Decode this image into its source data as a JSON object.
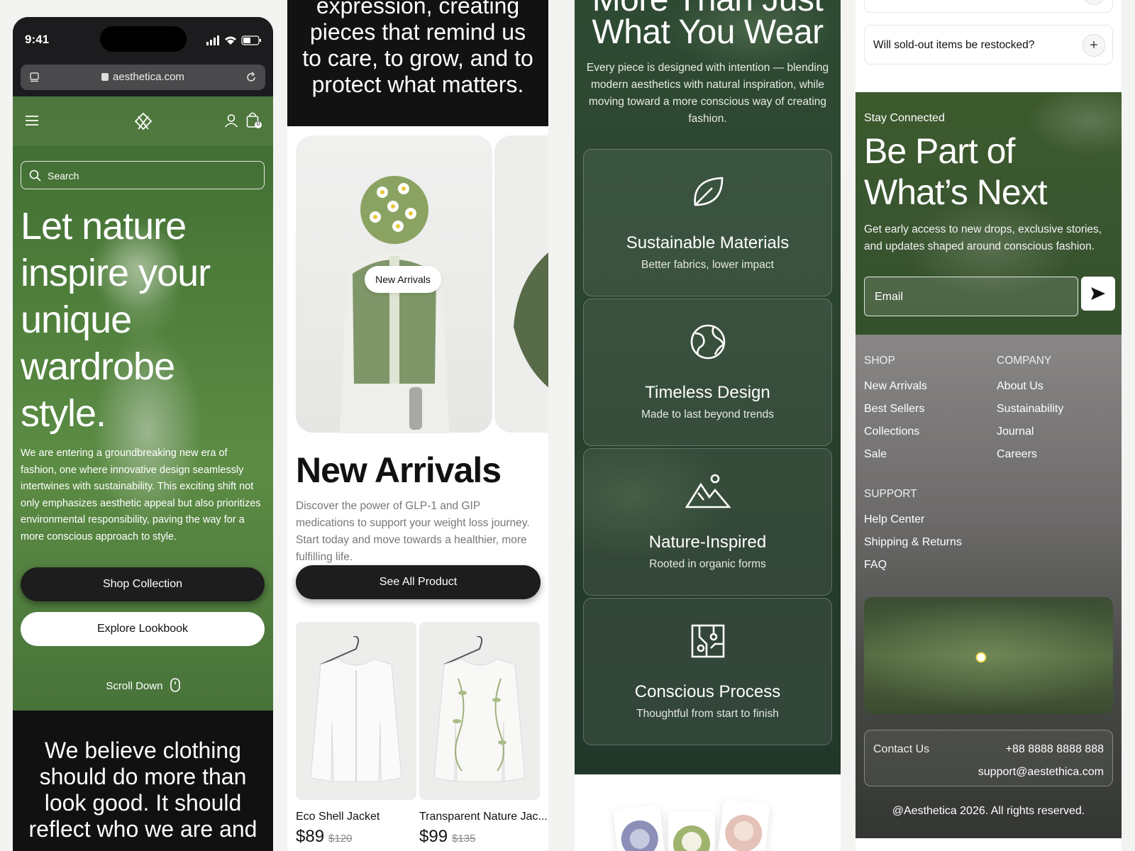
{
  "phone": {
    "time": "9:41",
    "url": "aesthetica.com",
    "search_placeholder": "Search",
    "hero_title": "Let nature inspire your unique wardrobe style.",
    "hero_text": "We are entering a groundbreaking new era of fashion, one where innovative design seamlessly intertwines with sustainability. This exciting shift not only emphasizes aesthetic appeal but also prioritizes environmental responsibility, paving the way for a more conscious approach to style.",
    "shop_button": "Shop Collection",
    "lookbook_button": "Explore Lookbook",
    "scroll_label": "Scroll Down",
    "cart_count": "0",
    "believe_text": "We believe clothing should do more than look good. It should reflect who we are and"
  },
  "col2": {
    "quote": "expression, creating pieces that remind us to care, to grow, and to protect what matters.",
    "pill_label": "New Arrivals",
    "title": "New Arrivals",
    "text": "Discover the power of GLP-1 and GIP medications to support your weight loss journey. Start today and move towards a healthier, more fulfilling life.",
    "see_all": "See All Product",
    "products": [
      {
        "name": "Eco Shell Jacket",
        "price": "$89",
        "old_price": "$120"
      },
      {
        "name": "Transparent Nature Jac...",
        "price": "$99",
        "old_price": "$135"
      }
    ]
  },
  "col3": {
    "heading_top": "More Than Just",
    "heading": "What You Wear",
    "text": "Every piece is designed with intention — blending modern aesthetics with natural inspiration, while moving toward a more conscious way of creating fashion.",
    "features": [
      {
        "title": "Sustainable Materials",
        "subtitle": "Better fabrics, lower impact",
        "icon": "leaf-icon"
      },
      {
        "title": "Timeless Design",
        "subtitle": "Made to last beyond trends",
        "icon": "globe-icon"
      },
      {
        "title": "Nature-Inspired",
        "subtitle": "Rooted in organic forms",
        "icon": "mountain-icon"
      },
      {
        "title": "Conscious Process",
        "subtitle": "Thoughtful from start to finish",
        "icon": "circuit-icon"
      }
    ]
  },
  "col4": {
    "faq_question": "Will sold-out items be restocked?",
    "stay_label": "Stay Connected",
    "stay_heading": "Be Part of What’s Next",
    "stay_text": "Get early access to new drops, exclusive stories, and updates shaped around conscious fashion.",
    "email_placeholder": "Email",
    "footer": {
      "shop_heading": "SHOP",
      "shop_links": [
        "New Arrivals",
        "Best Sellers",
        "Collections",
        "Sale"
      ],
      "company_heading": "COMPANY",
      "company_links": [
        "About Us",
        "Sustainability",
        "Journal",
        "Careers"
      ],
      "support_heading": "SUPPORT",
      "support_links": [
        "Help Center",
        "Shipping & Returns",
        "FAQ"
      ],
      "contact_label": "Contact Us",
      "phone": "+88 8888 8888 888",
      "email": "support@aestethica.com",
      "copyright": "@Aesthetica 2026. All rights reserved."
    }
  }
}
